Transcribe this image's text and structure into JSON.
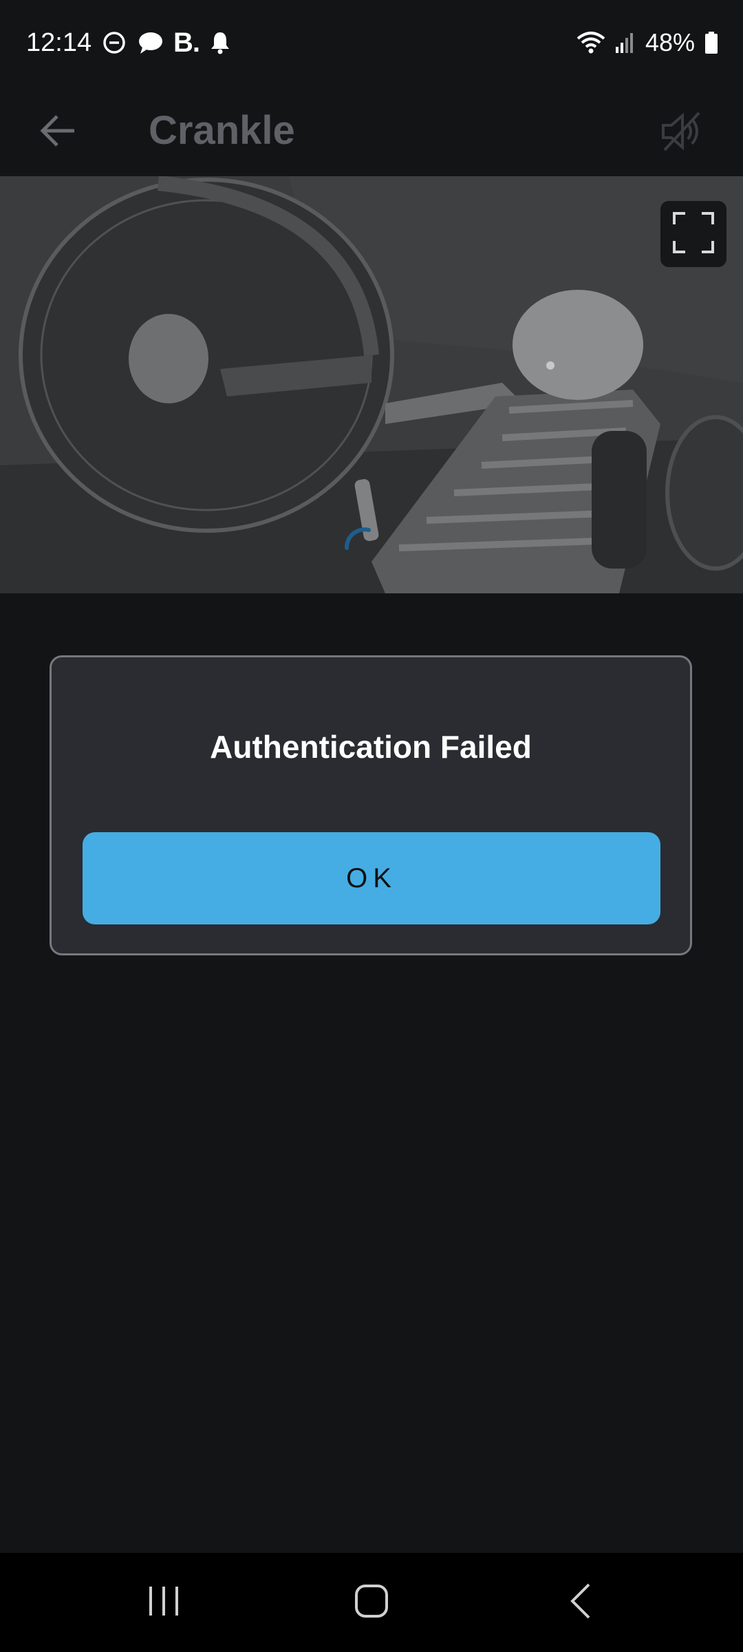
{
  "status_bar": {
    "time": "12:14",
    "left_icons": [
      "do-not-disturb-icon",
      "chat-bubble-icon",
      "b-app-icon",
      "notification-bell-icon"
    ],
    "b_logo_text": "B.",
    "right_icons": [
      "wifi-icon",
      "cellular-signal-icon",
      "battery-icon"
    ],
    "battery_percent": "48%"
  },
  "app_bar": {
    "back_icon": "arrow-back-icon",
    "title": "Crankle",
    "mute_icon": "speaker-muted-icon"
  },
  "video": {
    "fullscreen_icon": "fullscreen-icon",
    "loading": true
  },
  "dialog": {
    "title": "Authentication Failed",
    "ok_label": "OK"
  },
  "nav_bar": {
    "recents_icon": "recent-apps-icon",
    "home_icon": "home-icon",
    "back_icon": "nav-back-icon"
  },
  "colors": {
    "background": "#131416",
    "dialog_bg": "#2a2c31",
    "dialog_border": "#76787d",
    "accent": "#45ade3",
    "title_muted": "#5f6166"
  }
}
